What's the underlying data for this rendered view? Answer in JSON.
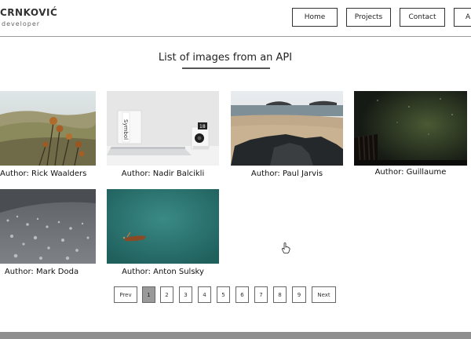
{
  "brand": {
    "name": "CRNKOVIĆ",
    "subtitle": "developer"
  },
  "nav": {
    "home": "Home",
    "projects": "Projects",
    "contact": "Contact",
    "about": "A"
  },
  "page": {
    "title": "List of images from an API"
  },
  "cards": [
    {
      "author": "Author: Rick Waalders",
      "image": "dry-flower-hills-photo"
    },
    {
      "author": "Author: Nadir Balcikli",
      "image": "desk-laptop-photo"
    },
    {
      "author": "Author: Paul Jarvis",
      "image": "beach-rocks-photo"
    },
    {
      "author": "Author: Guillaume",
      "image": "night-sky-fence-photo"
    },
    {
      "author": "Author: Mark Doda",
      "image": "water-droplets-photo"
    },
    {
      "author": "Author: Anton Sulsky",
      "image": "lake-boat-photo"
    }
  ],
  "pagination": {
    "prev": "Prev",
    "next": "Next",
    "pages": [
      "1",
      "2",
      "3",
      "4",
      "5",
      "6",
      "7",
      "8",
      "9"
    ],
    "current": "1"
  },
  "photo_text": {
    "book_spine": "Symbol",
    "speaker_label": "18"
  },
  "colors": {
    "active_page": "#9a9a9a",
    "footer": "#8f8f8f"
  }
}
